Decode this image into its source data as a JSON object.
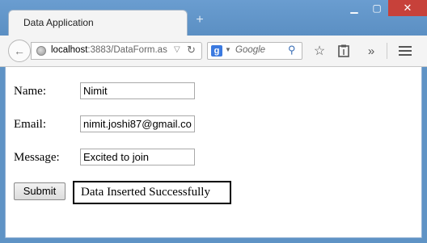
{
  "window": {
    "tab_title": "Data Application",
    "new_tab_symbol": "+",
    "minimize_symbol": "▁",
    "maximize_symbol": "▢",
    "close_symbol": "✕"
  },
  "toolbar": {
    "url_host": "localhost",
    "url_rest": ":3883/DataForm.as",
    "search_engine_letter": "g",
    "search_placeholder": "Google",
    "more_symbol": "»"
  },
  "form": {
    "name_label": "Name:",
    "name_value": "Nimit",
    "email_label": "Email:",
    "email_value": "nimit.joshi87@gmail.co",
    "message_label": "Message:",
    "message_value": "Excited to join",
    "submit_label": "Submit",
    "status_message": "Data Inserted Successfully"
  },
  "colors": {
    "frame": "#5f93c5",
    "close_button": "#c7413a",
    "status_border": "#000000"
  },
  "icons": [
    "back-arrow-icon",
    "globe-icon",
    "reload-icon",
    "search-icon",
    "bookmark-star-icon",
    "clipboard-icon",
    "overflow-chevron-icon",
    "hamburger-menu-icon"
  ]
}
